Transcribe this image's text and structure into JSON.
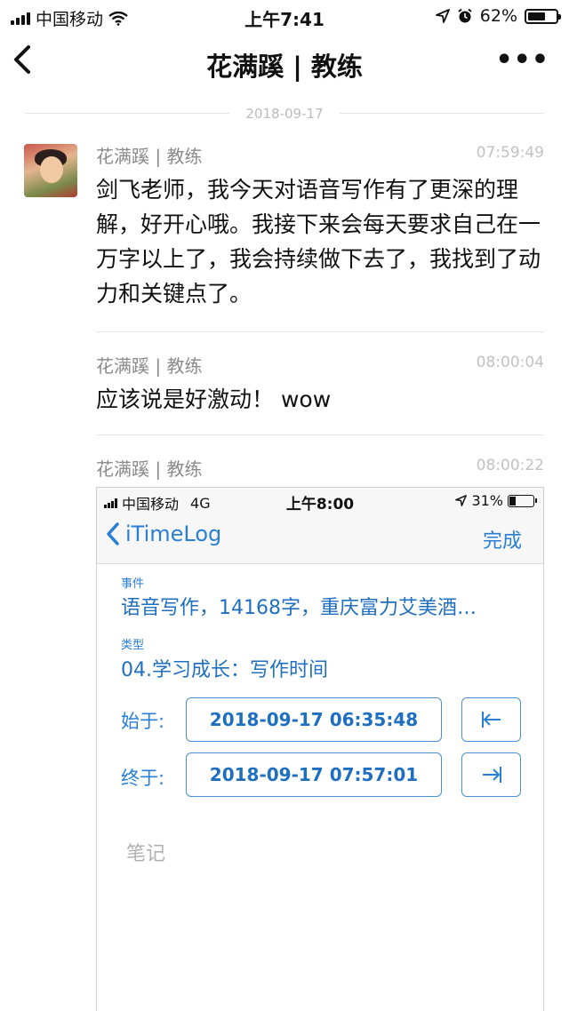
{
  "status": {
    "carrier": "中国移动",
    "time": "上午7:41",
    "battery": "62%",
    "battery_level": 0.62
  },
  "nav": {
    "back": "<",
    "title": "花满蹊 | 教练",
    "more": "•••"
  },
  "date_divider": "2018-09-17",
  "messages": [
    {
      "sender": "花满蹊 | 教练",
      "time": "07:59:49",
      "text": "剑飞老师，我今天对语音写作有了更深的理解，好开心哦。我接下来会每天要求自己在一万字以上了，我会持续做下去了，我找到了动力和关键点了。"
    },
    {
      "sender": "花满蹊 | 教练",
      "time": "08:00:04",
      "text": "应该说是好激动！ wow"
    },
    {
      "sender": "花满蹊 | 教练",
      "time": "08:00:22"
    }
  ],
  "screenshot": {
    "status": {
      "carrier": "中国移动",
      "network": "4G",
      "time": "上午8:00",
      "battery": "31%",
      "battery_level": 0.31
    },
    "nav": {
      "back": "iTimeLog",
      "done": "完成"
    },
    "event_label": "事件",
    "event_value": "语音写作，14168字，重庆富力艾美酒…",
    "type_label": "类型",
    "type_value": "04.学习成长：写作时间",
    "start_label": "始于:",
    "start_value": "2018-09-17 06:35:48",
    "end_label": "终于:",
    "end_value": "2018-09-17 07:57:01",
    "notes_placeholder": "笔记"
  },
  "colors": {
    "accent_blue": "#2a7fd4",
    "divider": "#e5e5e5"
  }
}
